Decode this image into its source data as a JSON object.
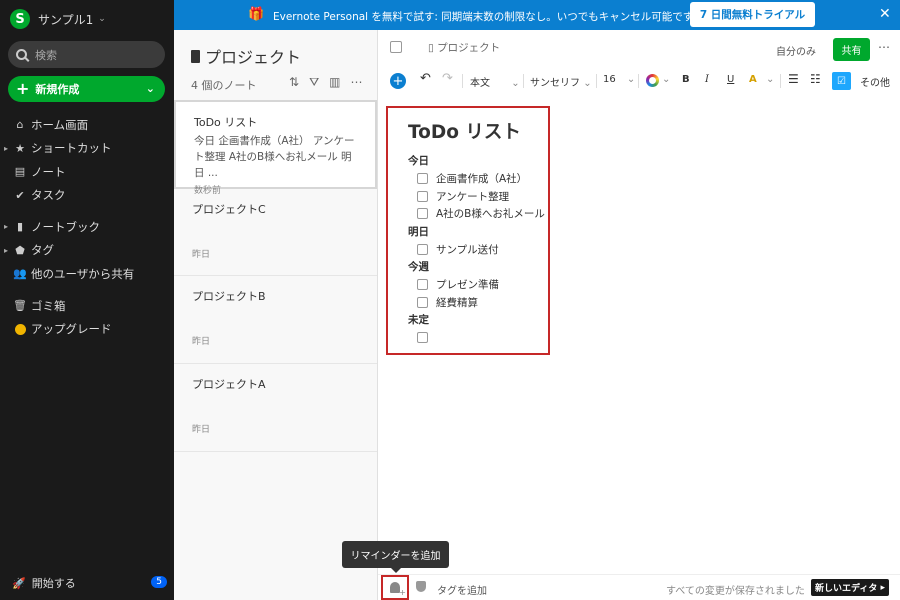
{
  "sidebar": {
    "account_name": "サンプル1",
    "logo_letter": "S",
    "search_placeholder": "検索",
    "new_button": "新規作成",
    "nav_group1": [
      {
        "label": "ホーム画面",
        "icon": "home-icon"
      },
      {
        "label": "ショートカット",
        "icon": "star-icon"
      },
      {
        "label": "ノート",
        "icon": "note-icon"
      },
      {
        "label": "タスク",
        "icon": "check-circle-icon"
      }
    ],
    "nav_group2": [
      {
        "label": "ノートブック",
        "icon": "notebook-icon"
      },
      {
        "label": "タグ",
        "icon": "tag-icon"
      },
      {
        "label": "他のユーザから共有",
        "icon": "people-icon"
      }
    ],
    "nav_group3": [
      {
        "label": "ゴミ箱",
        "icon": "trash-icon"
      },
      {
        "label": "アップグレード",
        "icon": "upgrade-icon"
      }
    ],
    "start_label": "開始する",
    "start_badge": "5"
  },
  "banner": {
    "text": "Evernote Personal を無料で試す: 同期端末数の制限なし。いつでもキャンセル可能です。",
    "button": "7 日間無料トライアル"
  },
  "notelist": {
    "title": "プロジェクト",
    "count": "4 個のノート",
    "notes": [
      {
        "title": "ToDo リスト",
        "snippet": "今日 企画書作成（A社） アンケート整理 A社のB様へお礼メール 明日 ...",
        "time": "数秒前"
      },
      {
        "title": "プロジェクトC",
        "snippet": "",
        "time": "昨日"
      },
      {
        "title": "プロジェクトB",
        "snippet": "",
        "time": "昨日"
      },
      {
        "title": "プロジェクトA",
        "snippet": "",
        "time": "昨日"
      }
    ]
  },
  "editor": {
    "breadcrumb": "プロジェクト",
    "only_me": "自分のみ",
    "share": "共有",
    "toolbar": {
      "style": "本文",
      "font": "サンセリフ",
      "size": "16",
      "bold": "B",
      "italic": "I",
      "underline": "U",
      "highlight": "A",
      "more": "その他"
    },
    "note_title": "ToDo リスト",
    "sections": [
      {
        "heading": "今日",
        "items": [
          "企画書作成（A社）",
          "アンケート整理",
          "A社のB様へお礼メール"
        ]
      },
      {
        "heading": "明日",
        "items": [
          "サンプル送付"
        ]
      },
      {
        "heading": "今週",
        "items": [
          "プレゼン準備",
          "経費精算"
        ]
      },
      {
        "heading": "未定",
        "items": [
          ""
        ]
      }
    ],
    "tooltip": "リマインダーを追加",
    "footer": {
      "tag_placeholder": "タグを追加",
      "saved": "すべての変更が保存されました",
      "new_editor": "新しいエディタ"
    }
  },
  "colors": {
    "sidebar_bg": "#1a1a1a",
    "accent_green": "#00a82d",
    "banner_blue": "#0b7fd0",
    "highlight_red": "#c62828"
  }
}
